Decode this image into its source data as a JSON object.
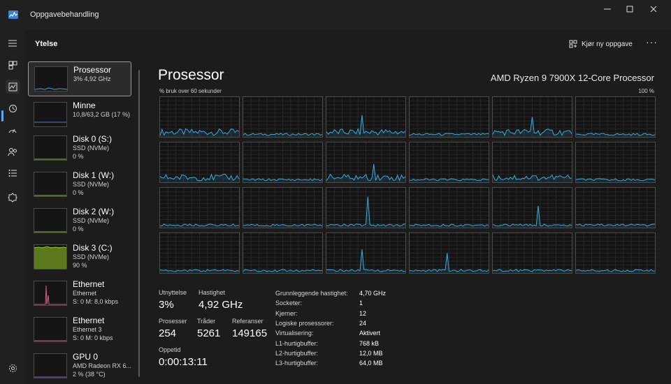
{
  "window": {
    "title": "Oppgavebehandling",
    "controls": [
      "minimize-icon",
      "maximize-icon",
      "close-icon"
    ]
  },
  "rail": {
    "icons": [
      "menu-icon",
      "processes-icon",
      "performance-icon",
      "history-icon",
      "startup-icon",
      "users-icon",
      "details-icon",
      "services-icon",
      "settings-icon"
    ]
  },
  "header": {
    "title": "Ytelse",
    "run_task_label": "Kjør ny oppgave",
    "more_label": "···"
  },
  "devices": [
    {
      "name": "Prosessor",
      "lines": [
        "3%  4,92 GHz"
      ],
      "selected": true,
      "color": "#4aa8d6"
    },
    {
      "name": "Minne",
      "lines": [
        "10,8/63,2 GB (17 %)"
      ],
      "color": "#4a7fd6"
    },
    {
      "name": "Disk 0 (S:)",
      "lines": [
        "SSD (NVMe)",
        "0 %"
      ],
      "color": "#8fbf3a"
    },
    {
      "name": "Disk 1 (W:)",
      "lines": [
        "SSD (NVMe)",
        "0 %"
      ],
      "color": "#8fbf3a"
    },
    {
      "name": "Disk 2 (W:)",
      "lines": [
        "SSD (NVMe)",
        "0 %"
      ],
      "color": "#8fbf3a"
    },
    {
      "name": "Disk 3 (C:)",
      "lines": [
        "SSD (NVMe)",
        "90 %"
      ],
      "color": "#8fbf3a"
    },
    {
      "name": "Ethernet",
      "lines": [
        "Ethernet",
        "S: 0  M: 8,0 kbps"
      ],
      "color": "#d65a8a"
    },
    {
      "name": "Ethernet",
      "lines": [
        "Ethernet 3",
        "S: 0  M: 0 kbps"
      ],
      "color": "#d65a8a"
    },
    {
      "name": "GPU 0",
      "lines": [
        "AMD Radeon RX 6...",
        "2 %  (38 °C)"
      ],
      "color": "#a05ad6"
    }
  ],
  "cpu": {
    "title": "Prosessor",
    "model": "AMD Ryzen 9 7900X 12-Core Processor",
    "graph_label": "% bruk over 60 sekunder",
    "graph_max": "100 %",
    "core_count": 24,
    "line_color": "#3fa8d8"
  },
  "stats": {
    "utilization_label": "Utnyttelse",
    "utilization": "3%",
    "speed_label": "Hastighet",
    "speed": "4,92 GHz",
    "processes_label": "Prosesser",
    "processes": "254",
    "threads_label": "Tråder",
    "threads": "5261",
    "handles_label": "Referanser",
    "handles": "149165",
    "uptime_label": "Oppetid",
    "uptime": "0:00:13:11"
  },
  "specs": [
    {
      "k": "Grunnleggende hastighet:",
      "v": "4,70 GHz"
    },
    {
      "k": "Socketer:",
      "v": "1"
    },
    {
      "k": "Kjerner:",
      "v": "12"
    },
    {
      "k": "Logiske prosessorer:",
      "v": "24"
    },
    {
      "k": "Virtualisering:",
      "v": "Aktivert"
    },
    {
      "k": "L1-hurtigbuffer:",
      "v": "768 kB"
    },
    {
      "k": "L2-hurtigbuffer:",
      "v": "12,0 MB"
    },
    {
      "k": "L3-hurtigbuffer:",
      "v": "64,0 MB"
    }
  ]
}
